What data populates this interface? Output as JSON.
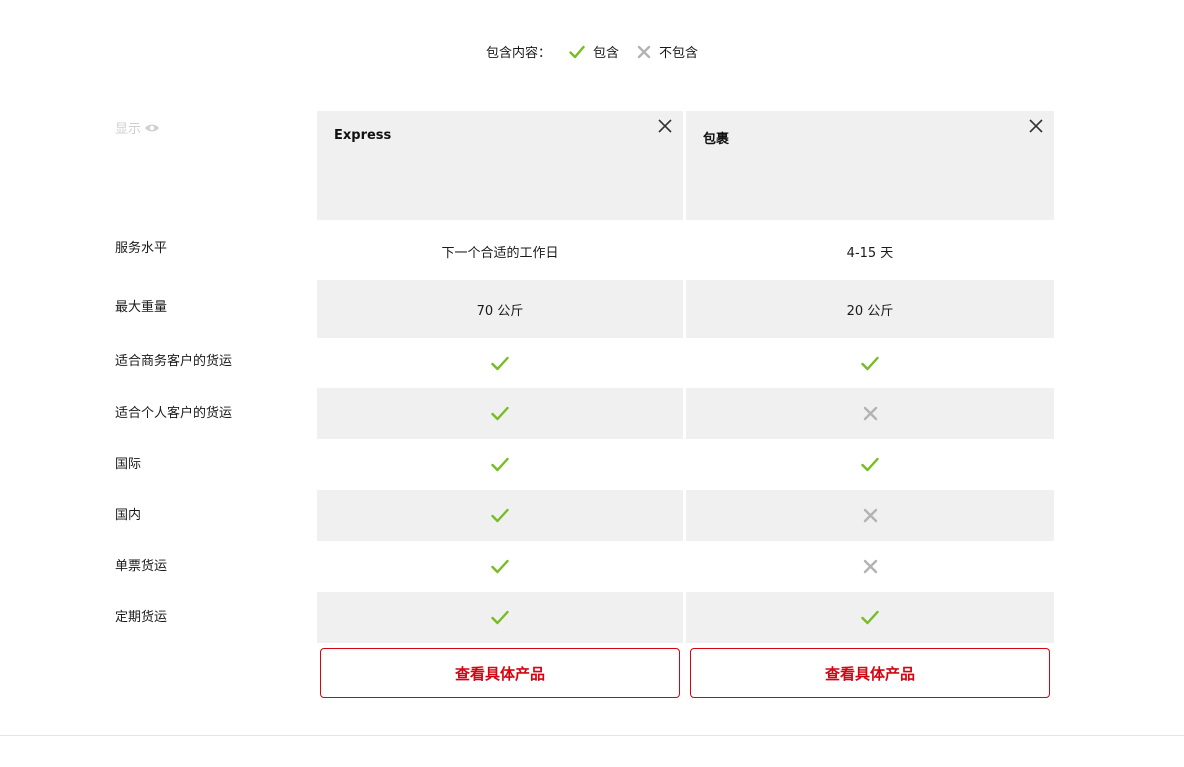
{
  "legend": {
    "label": "包含内容：",
    "included": "包含",
    "excluded": "不包含"
  },
  "show_toggle": {
    "label": "显示"
  },
  "products": [
    {
      "name": "Express",
      "button": "查看具体产品"
    },
    {
      "name": "包裹",
      "button": "查看具体产品"
    }
  ],
  "rows": [
    {
      "label": "服务水平",
      "values": [
        "下一个合适的工作日",
        "4-15 天"
      ]
    },
    {
      "label": "最大重量",
      "values": [
        "70 公斤",
        "20 公斤"
      ]
    },
    {
      "label": "适合商务客户的货运",
      "values": [
        true,
        true
      ]
    },
    {
      "label": "适合个人客户的货运",
      "values": [
        true,
        false
      ]
    },
    {
      "label": "国际",
      "values": [
        true,
        true
      ]
    },
    {
      "label": "国内",
      "values": [
        true,
        false
      ]
    },
    {
      "label": "单票货运",
      "values": [
        true,
        false
      ]
    },
    {
      "label": "定期货运",
      "values": [
        true,
        true
      ]
    }
  ],
  "colors": {
    "check": "#76bd22",
    "cross": "#b3b3b3",
    "accent": "#d40511",
    "shade": "#f0f0f0"
  },
  "icons": {
    "check": "check-icon",
    "cross": "cross-icon",
    "close": "close-icon",
    "eye": "eye-icon"
  }
}
